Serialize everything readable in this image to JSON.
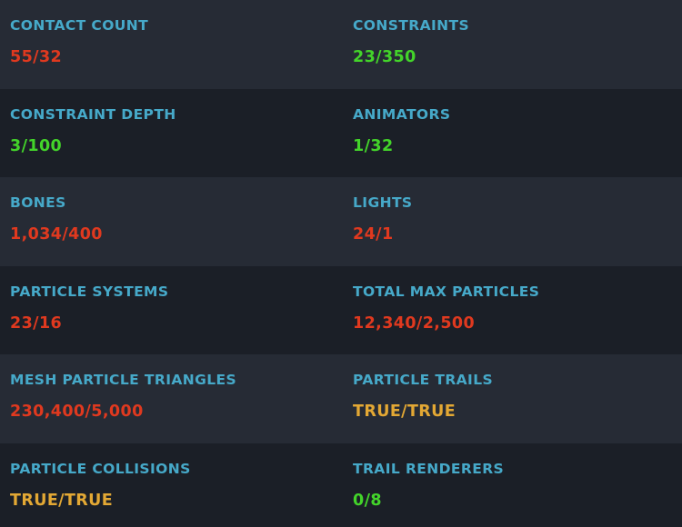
{
  "colors": {
    "label": "#46a9c9",
    "over_limit": "#e0391f",
    "within_limit": "#43d42a",
    "boolean": "#e3a834",
    "row_odd": "#262b35",
    "row_even": "#1b1f27"
  },
  "stats": [
    {
      "label": "CONTACT COUNT",
      "value": "55/32",
      "status": "over"
    },
    {
      "label": "CONSTRAINTS",
      "value": "23/350",
      "status": "ok"
    },
    {
      "label": "CONSTRAINT DEPTH",
      "value": "3/100",
      "status": "ok"
    },
    {
      "label": "ANIMATORS",
      "value": "1/32",
      "status": "ok"
    },
    {
      "label": "BONES",
      "value": "1,034/400",
      "status": "over"
    },
    {
      "label": "LIGHTS",
      "value": "24/1",
      "status": "over"
    },
    {
      "label": "PARTICLE SYSTEMS",
      "value": "23/16",
      "status": "over"
    },
    {
      "label": "TOTAL MAX PARTICLES",
      "value": "12,340/2,500",
      "status": "over"
    },
    {
      "label": "MESH PARTICLE TRIANGLES",
      "value": "230,400/5,000",
      "status": "over"
    },
    {
      "label": "PARTICLE TRAILS",
      "value": "TRUE/TRUE",
      "status": "bool"
    },
    {
      "label": "PARTICLE COLLISIONS",
      "value": "TRUE/TRUE",
      "status": "bool"
    },
    {
      "label": "TRAIL RENDERERS",
      "value": "0/8",
      "status": "ok"
    }
  ]
}
